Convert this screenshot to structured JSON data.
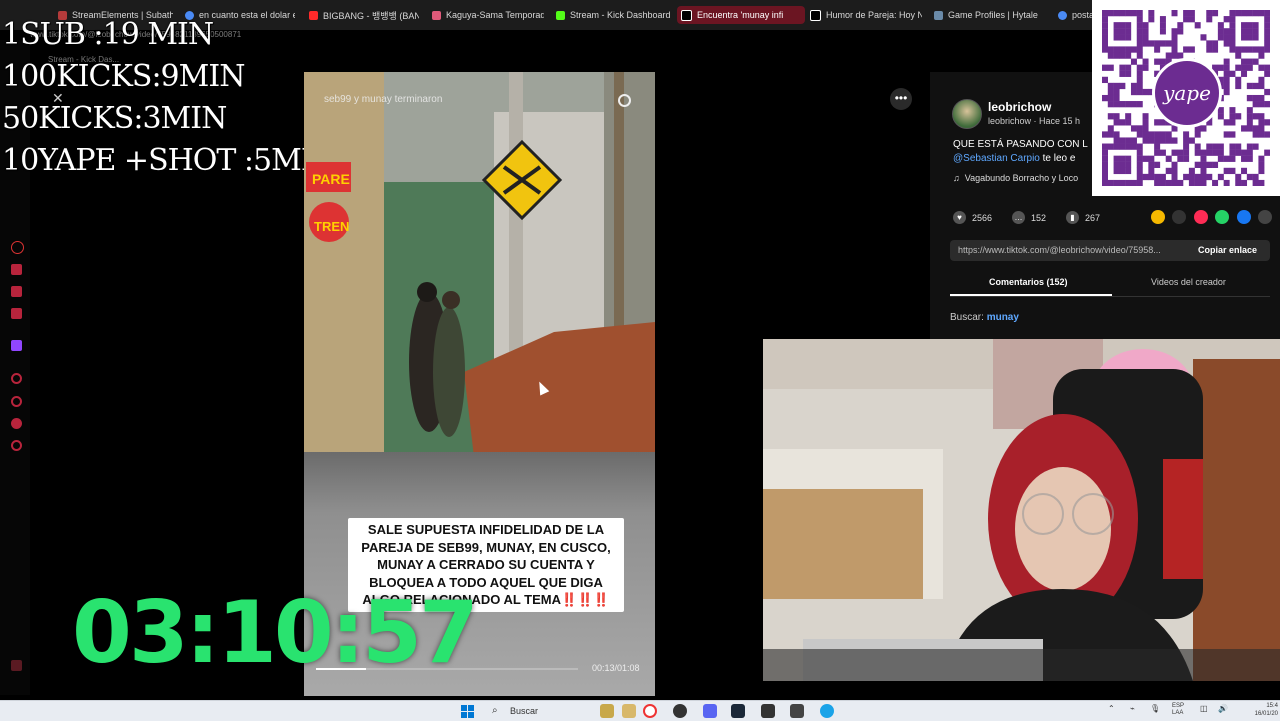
{
  "browser": {
    "tabs": [
      {
        "label": "StreamElements | Subath",
        "color": "#b43b3b"
      },
      {
        "label": "en cuanto esta el dolar e",
        "color": "#4a8af4"
      },
      {
        "label": "BIGBANG - 뱅뱅뱅 (BAN",
        "color": "#ff2a2a"
      },
      {
        "label": "Kaguya-Sama Temporad",
        "color": "#e05a7a"
      },
      {
        "label": "Stream - Kick Dashboard",
        "color": "#53fc18"
      },
      {
        "label": "Encuentra 'munay infi",
        "color": "#000000"
      },
      {
        "label": "Humor de Pareja: Hoy N",
        "color": "#000000"
      },
      {
        "label": "Game Profiles | Hytale",
        "color": "#6a8aa8"
      },
      {
        "label": "posta",
        "color": "#4a8af4"
      }
    ],
    "url": "www.tiktok.com/@leobrichow/video/7595821189650500871",
    "subtab": "Stream - Kick Das..."
  },
  "overlay": {
    "goals": [
      "1SUB :19 MIN",
      "100KICKS:9MIN",
      "50KICKS:3MIN",
      "10YAPE +SHOT :5MIN"
    ],
    "timer": "03:10:57"
  },
  "video": {
    "search_text": "seb99 y munay terminaron",
    "caption_lines": [
      "SALE SUPUESTA INFIDELIDAD DE LA",
      "PAREJA DE SEB99, MUNAY, EN CUSCO,",
      "MUNAY A CERRADO SU CUENTA  Y",
      "BLOQUEA A TODO AQUEL QUE DIGA",
      "ALGO RELACIONADO AL TEMA"
    ],
    "caption_emphasis": "‼️‼️‼️",
    "sign_text": "TREN",
    "sign_text2": "PARE",
    "time": "00:13/01:08",
    "progress": 0.19
  },
  "tiktok": {
    "username": "leobrichow",
    "meta": "leobrichow · Hace 15 h",
    "description": "QUE ESTÁ PASANDO CON L",
    "mention": "@Sebastian Carpio",
    "mention_suffix": " te leo e",
    "music": "Vagabundo Borracho y Loco",
    "likes": "2566",
    "comments": "152",
    "saves": "267",
    "link": "https://www.tiktok.com/@leobrichow/video/75958...",
    "copy_label": "Copiar enlace",
    "tab_comments": "Comentarios (152)",
    "tab_videos": "Videos del creador",
    "search_label": "Buscar:",
    "search_value": "munay",
    "share_colors": [
      "#f5b800",
      "#333333",
      "#fe2c55",
      "#25d366",
      "#1877f2",
      "#444444"
    ]
  },
  "qr": {
    "brand": "yape",
    "color": "#6c2c91"
  },
  "taskbar": {
    "search_label": "Buscar",
    "lang_top": "ESP",
    "lang_bottom": "LAA",
    "time": "15:4",
    "date": "16/01/20"
  }
}
